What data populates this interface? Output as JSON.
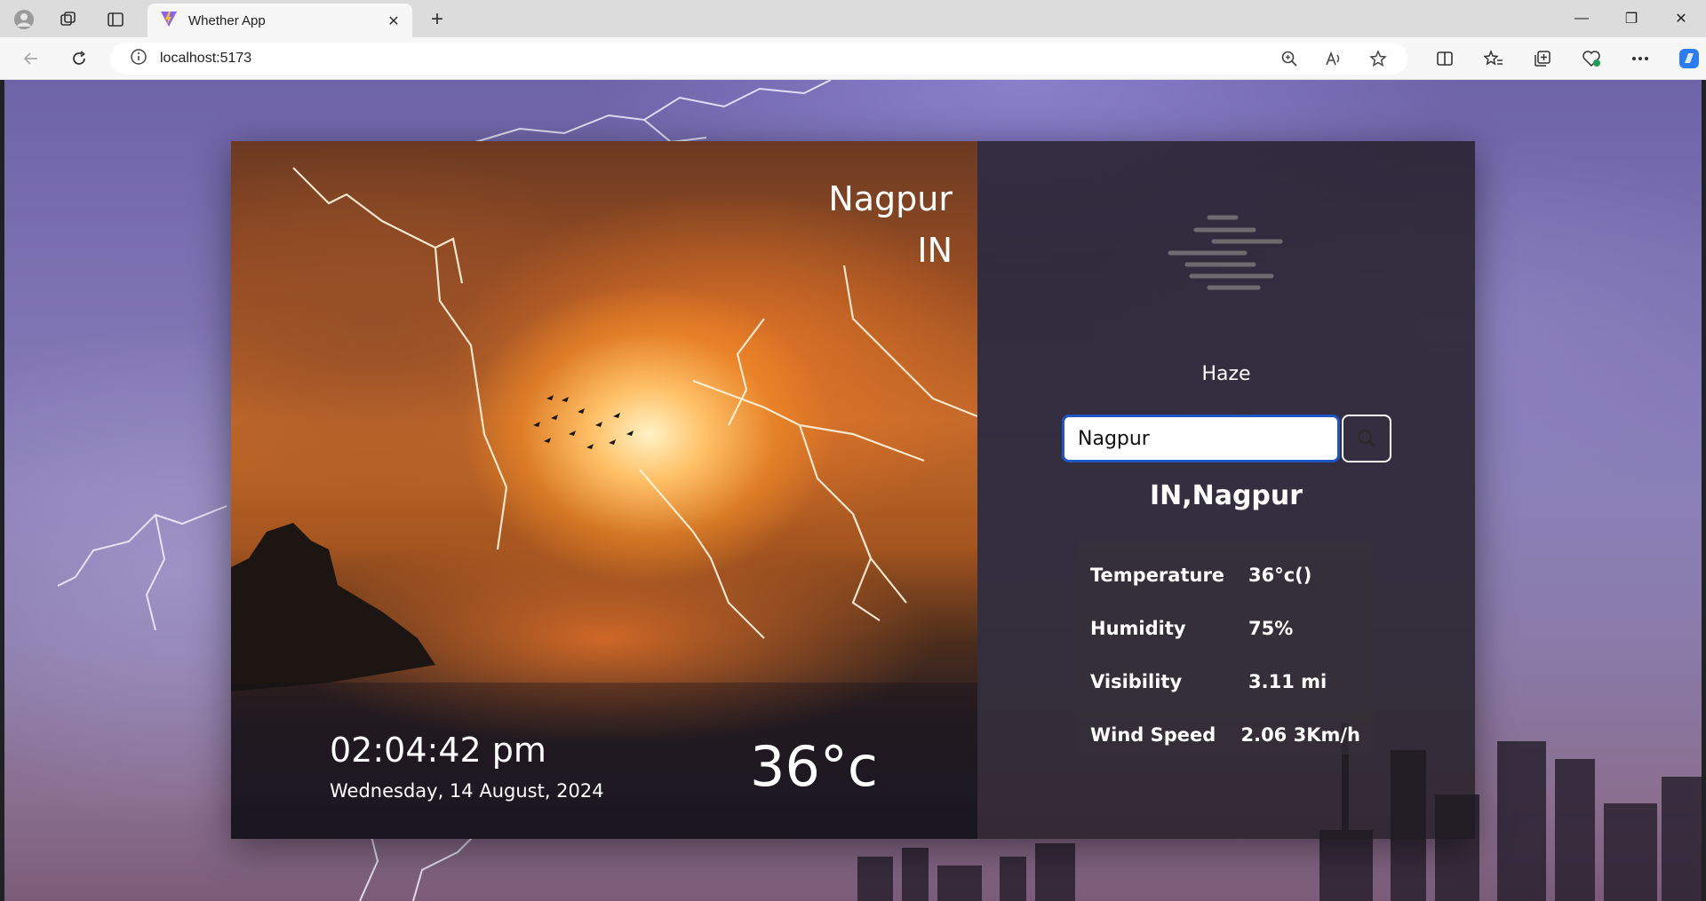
{
  "browser": {
    "tab_title": "Whether App",
    "url": "localhost:5173",
    "close_tab_glyph": "✕",
    "new_tab_glyph": "+",
    "window_controls": {
      "minimize": "—",
      "restore": "❐",
      "close": "✕"
    }
  },
  "app": {
    "city": "Nagpur",
    "country": "IN",
    "time": "02:04:42 pm",
    "date": "Wednesday, 14 August, 2024",
    "temperature_big": "36°c",
    "condition": "Haze",
    "condition_icon": "haze-icon",
    "search": {
      "value": "Nagpur",
      "icon": "search-icon"
    },
    "location_heading": "IN,Nagpur",
    "stats": [
      {
        "label": "Temperature",
        "value": "36°c()"
      },
      {
        "label": "Humidity",
        "value": "75%"
      },
      {
        "label": "Visibility",
        "value": "3.11 mi"
      },
      {
        "label": "Wind Speed",
        "value": "2.06 3Km/h"
      }
    ]
  },
  "colors": {
    "accent_input_border": "#1f55c4",
    "panel_dark": "#1c181e",
    "text": "#ffffff"
  }
}
